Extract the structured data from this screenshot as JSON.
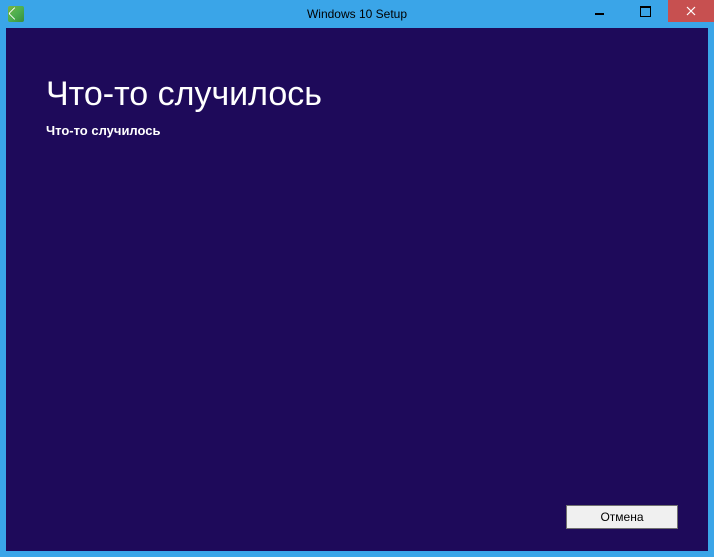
{
  "window": {
    "title": "Windows 10 Setup"
  },
  "content": {
    "heading": "Что-то случилось",
    "message": "Что-то случилось"
  },
  "buttons": {
    "cancel": "Отмена"
  },
  "colors": {
    "titlebar": "#3aa5e8",
    "content_bg": "#1e0a5a",
    "close_btn": "#c75050"
  }
}
